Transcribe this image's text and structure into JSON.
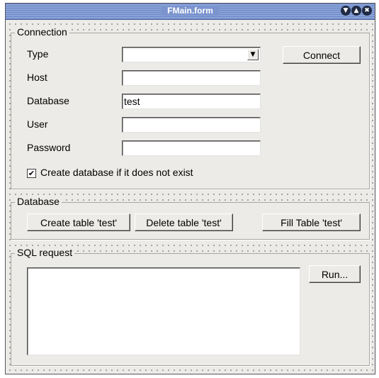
{
  "window": {
    "title": "FMain.form",
    "controls": [
      "minimize-icon",
      "maximize-icon",
      "close-icon"
    ]
  },
  "connection": {
    "group_title": "Connection",
    "type_label": "Type",
    "type_value": "",
    "host_label": "Host",
    "host_value": "",
    "database_label": "Database",
    "database_value": "test",
    "user_label": "User",
    "user_value": "",
    "password_label": "Password",
    "password_value": "",
    "create_db_label": "Create database if it does not exist",
    "create_db_checked": true,
    "connect_button": "Connect"
  },
  "database": {
    "group_title": "Database",
    "create_table_button": "Create table 'test'",
    "delete_table_button": "Delete table 'test'",
    "fill_table_button": "Fill Table 'test'"
  },
  "sql": {
    "group_title": "SQL request",
    "request_text": "",
    "run_button": "Run..."
  }
}
